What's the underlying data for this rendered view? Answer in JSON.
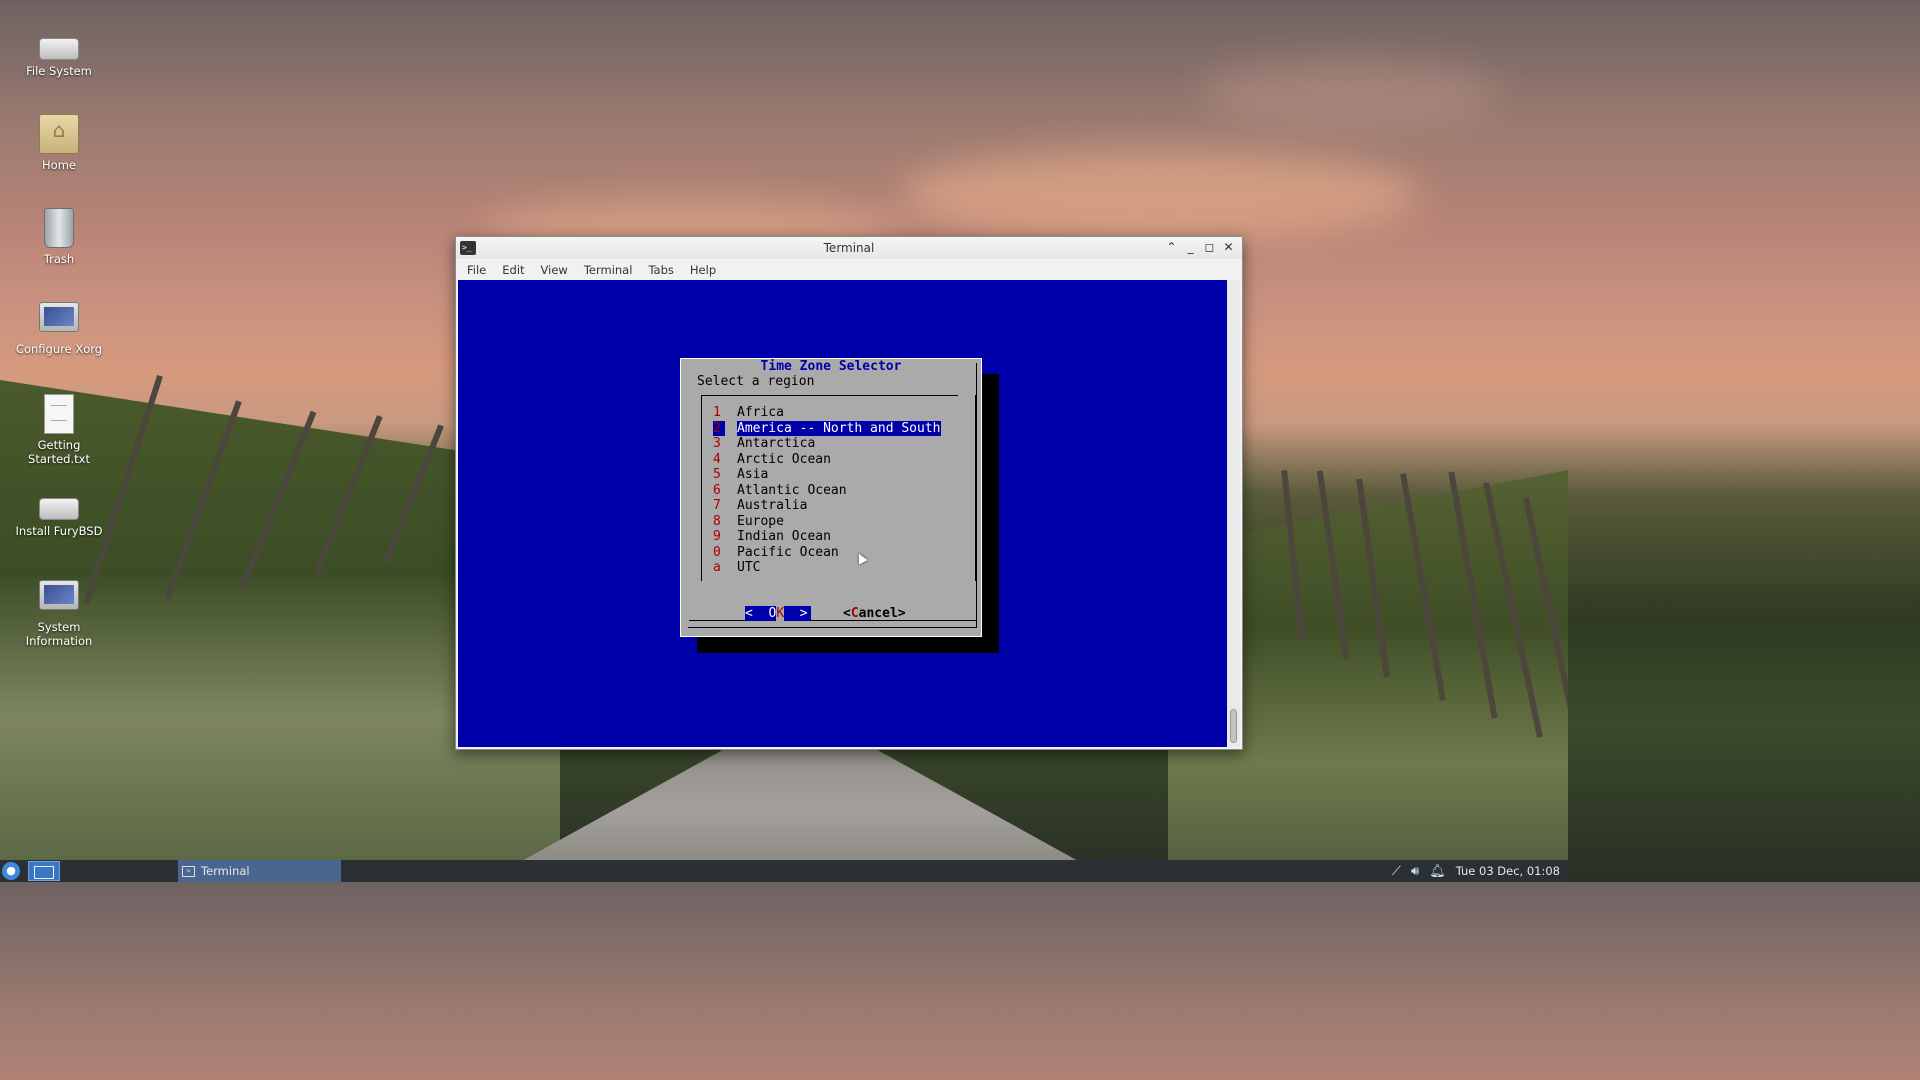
{
  "desktop": {
    "icons": [
      {
        "label": "File System",
        "icon": "drive-icon"
      },
      {
        "label": "Home",
        "icon": "home-folder-icon"
      },
      {
        "label": "Trash",
        "icon": "trash-icon"
      },
      {
        "label": "Configure Xorg",
        "icon": "monitor-icon"
      },
      {
        "label": "Getting Started.txt",
        "icon": "text-document-icon"
      },
      {
        "label": "Install FuryBSD",
        "icon": "installer-drive-icon"
      },
      {
        "label": "System Information",
        "icon": "computer-icon"
      }
    ]
  },
  "window": {
    "title": "Terminal",
    "menu": [
      "File",
      "Edit",
      "View",
      "Terminal",
      "Tabs",
      "Help"
    ]
  },
  "dialog": {
    "title": "Time Zone Selector",
    "prompt": "Select a region",
    "items": [
      {
        "tag": "1",
        "label": "Africa"
      },
      {
        "tag": "2",
        "label": "America -- North and South"
      },
      {
        "tag": "3",
        "label": "Antarctica"
      },
      {
        "tag": "4",
        "label": "Arctic Ocean"
      },
      {
        "tag": "5",
        "label": "Asia"
      },
      {
        "tag": "6",
        "label": "Atlantic Ocean"
      },
      {
        "tag": "7",
        "label": "Australia"
      },
      {
        "tag": "8",
        "label": "Europe"
      },
      {
        "tag": "9",
        "label": "Indian Ocean"
      },
      {
        "tag": "0",
        "label": "Pacific Ocean"
      },
      {
        "tag": "a",
        "label": "UTC"
      }
    ],
    "selected_index": 1,
    "ok_label_pre": "<  O",
    "ok_label_hot": "K",
    "ok_label_post": "  >",
    "cancel_label_pre": "<",
    "cancel_label_hot": "C",
    "cancel_label_post": "ancel>"
  },
  "taskbar": {
    "task_label": "Terminal",
    "clock": "Tue 03 Dec, 01:08"
  },
  "colors": {
    "terminal_bg": "#0000aa",
    "dialog_bg": "#aaaaaa",
    "hotkey": "#aa0000",
    "taskbar_bg": "#2b3035"
  }
}
